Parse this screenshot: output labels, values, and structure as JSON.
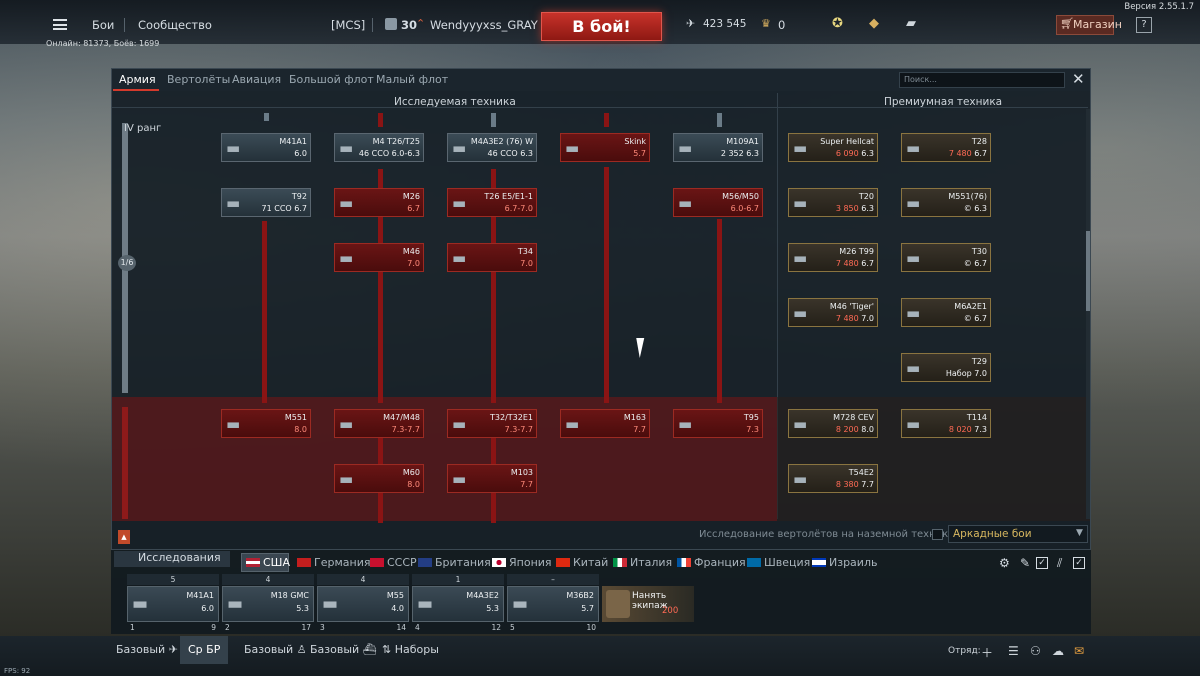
{
  "topbar": {
    "menu_icon": "hamburger-icon",
    "battles": "Бои",
    "community": "Сообщество",
    "clan_tag": "[MCS]",
    "level": "30",
    "username": "Wendyyyxss_GRAY",
    "to_battle": "В бой!",
    "silver": "423 545",
    "golden_eagles": "0",
    "shop": "Магазин",
    "help": "?",
    "online": "Онлайн: 81373, Боёв: 1699",
    "version": "Версия 2.55.1.7"
  },
  "tabs": [
    "Армия",
    "Вертолёты",
    "Авиация",
    "Большой флот",
    "Малый флот"
  ],
  "search_placeholder": "Поиск...",
  "headers": {
    "researchable": "Исследуемая техника",
    "premium": "Премиумная техника"
  },
  "rank_label": "IV ранг",
  "rank_progress": "1/6",
  "tree": {
    "col1": [
      {
        "name": "M41A1",
        "br": "6.0"
      },
      {
        "name": "T92",
        "br": "71 ССО 6.7"
      },
      {
        "name": "M551",
        "br": "8.0"
      }
    ],
    "col2": [
      {
        "name": "M4 T26/T25",
        "br": "46 ССО 6.0-6.3"
      },
      {
        "name": "M26",
        "br": "6.7"
      },
      {
        "name": "M46",
        "br": "7.0"
      },
      {
        "name": "M47/M48",
        "br": "7.3-7.7"
      },
      {
        "name": "M60",
        "br": "8.0"
      }
    ],
    "col3": [
      {
        "name": "M4A3E2 (76) W",
        "br": "46 ССО 6.3"
      },
      {
        "name": "T26 E5/E1-1",
        "br": "6.7-7.0"
      },
      {
        "name": "T34",
        "br": "7.0"
      },
      {
        "name": "T32/T32E1",
        "br": "7.3-7.7"
      },
      {
        "name": "M103",
        "br": "7.7"
      }
    ],
    "col4": [
      {
        "name": "Skink",
        "br": "5.7"
      },
      {
        "name": "M163",
        "br": "7.7"
      }
    ],
    "col5": [
      {
        "name": "M109A1",
        "br": "2 352 6.3"
      },
      {
        "name": "M56/M50",
        "br": "6.0-6.7"
      },
      {
        "name": "T95",
        "br": "7.3"
      }
    ]
  },
  "premium": [
    {
      "name": "Super Hellcat",
      "cost": "6 090",
      "br": "6.3"
    },
    {
      "name": "T28",
      "cost": "7 480",
      "br": "6.7"
    },
    {
      "name": "T20",
      "cost": "3 850",
      "br": "6.3"
    },
    {
      "name": "M551(76)",
      "cost": "©",
      "br": "6.3"
    },
    {
      "name": "M26 T99",
      "cost": "7 480",
      "br": "6.7"
    },
    {
      "name": "T30",
      "cost": "©",
      "br": "6.7"
    },
    {
      "name": "M46 'Tiger'",
      "cost": "7 480",
      "br": "7.0"
    },
    {
      "name": "M6A2E1",
      "cost": "©",
      "br": "6.7"
    },
    {
      "name": "T29",
      "cost": "Набор",
      "br": "7.0"
    },
    {
      "name": "M728 CEV",
      "cost": "8 200",
      "br": "8.0"
    },
    {
      "name": "T114",
      "cost": "8 020",
      "br": "7.3"
    },
    {
      "name": "T54E2",
      "cost": "8 380",
      "br": "7.7"
    }
  ],
  "heli_research": "Исследование вертолётов на наземной технике",
  "game_mode": "Аркадные бои",
  "research_label": "Исследования",
  "nations": [
    "США",
    "Германия",
    "СССР",
    "Британия",
    "Япония",
    "Китай",
    "Италия",
    "Франция",
    "Швеция",
    "Израиль"
  ],
  "slots": [
    {
      "head": "5",
      "name": "M41A1",
      "br": "6.0",
      "num": "1",
      "extra": "9"
    },
    {
      "head": "4",
      "name": "M18 GMC",
      "br": "5.3",
      "num": "2",
      "extra": "17"
    },
    {
      "head": "4",
      "name": "M55",
      "br": "4.0",
      "num": "3",
      "extra": "14"
    },
    {
      "head": "1",
      "name": "M4A3E2",
      "br": "5.3",
      "num": "4",
      "extra": "12"
    },
    {
      "head": "–",
      "name": "M36B2",
      "br": "5.7",
      "num": "5",
      "extra": "10"
    }
  ],
  "crew": {
    "label": "Нанять экипаж",
    "cost": "200"
  },
  "bottom_tabs": [
    "Базовый",
    "Ср БР",
    "Базовый",
    "Базовый",
    "Наборы"
  ],
  "squad": "Отряд:",
  "fps": "FPS: 92",
  "colors": {
    "accent_red": "#c7322a",
    "gold": "#d8b060"
  }
}
